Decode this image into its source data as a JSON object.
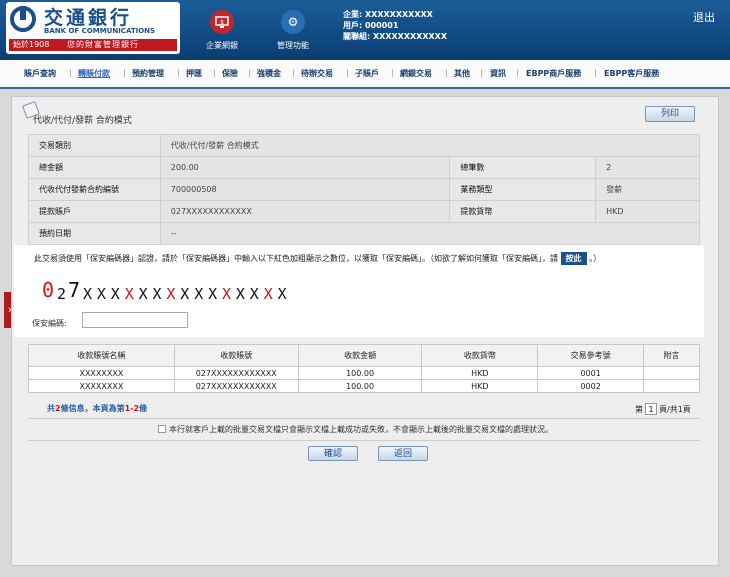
{
  "header": {
    "logo_cn": "交通銀行",
    "logo_en": "BANK OF COMMUNICATIONS",
    "logo_since": "始於1908",
    "logo_slogan": "您的財富管理銀行",
    "nav": [
      {
        "label": "企業網銀",
        "icon": "corporate-banking-icon",
        "color": "#c0262a"
      },
      {
        "label": "管理功能",
        "icon": "gear-icon",
        "color": "#2a6fb5"
      }
    ],
    "account": {
      "company": "企業: XXXXXXXXXXX",
      "user": "用戶: 000001",
      "group": "關聯組: XXXXXXXXXXXX"
    },
    "logout": "退出"
  },
  "menu": {
    "items": [
      "賬戶查詢",
      "轉賬付款",
      "預約管理",
      "押匯",
      "保險",
      "強積金",
      "待辦交易",
      "子賬戶",
      "網銀交易",
      "其他",
      "資訊",
      "EBPP商戶服務",
      "EBPP客戶服務"
    ],
    "active": "轉賬付款"
  },
  "page": {
    "title": "代收/代付/發薪 合約模式",
    "print_button": "列印"
  },
  "info": {
    "rows": [
      {
        "label": "交易類別",
        "value": "代收/代付/發薪 合約模式"
      },
      {
        "label": "總金額",
        "value": "200.00",
        "label2": "總筆數",
        "value2": "2"
      },
      {
        "label": "代收代付發薪合約編號",
        "value": "700000508",
        "label2": "業務類型",
        "value2": "發薪"
      },
      {
        "label": "提款賬戶",
        "value": "027XXXXXXXXXXXX",
        "label2": "提款貨幣",
        "value2": "HKD"
      },
      {
        "label": "預約日期",
        "value": "--"
      }
    ]
  },
  "security": {
    "note": "此交易須使用「保安編碼器」認證，請於「保安編碼器」中輸入以下紅色加粗顯示之數位，以獲取「保安編碼」。（如欲了解如何獲取「保安編碼」，請",
    "here": "按此",
    "note_end": "。）",
    "code_chars": [
      "0",
      "2",
      "7",
      "X",
      "X",
      "X",
      "X",
      "X",
      "X",
      "X",
      "X",
      "X",
      "X",
      "X",
      "X",
      "X",
      "X",
      "X"
    ],
    "code_red_index": [
      0,
      6,
      9,
      13,
      16
    ],
    "password_label": "保安編碼:",
    "password_value": ""
  },
  "list": {
    "headers": [
      "收款賬號名稱",
      "收款賬號",
      "收款金額",
      "收款貨幣",
      "交易參考號",
      "附言"
    ],
    "rows": [
      [
        "XXXXXXXX",
        "027XXXXXXXXXXXX",
        "100.00",
        "HKD",
        "0001",
        ""
      ],
      [
        "XXXXXXXX",
        "027XXXXXXXXXXXX",
        "100.00",
        "HKD",
        "0002",
        ""
      ]
    ]
  },
  "pagination": {
    "p1": "共",
    "count": "2",
    "p2": "條信息，本頁為第",
    "from": "1",
    "dash": "-",
    "to": "2",
    "p3": "條",
    "page_label": "第",
    "page_num": "1",
    "page_suffix": "頁/共1頁"
  },
  "disclaimer": "本行就客戶上載的批量交易文檔只會顯示文檔上載成功或失敗，不會顯示上載後的批量交易文檔的處理狀況。",
  "actions": {
    "confirm": "確認",
    "back": "返回"
  }
}
